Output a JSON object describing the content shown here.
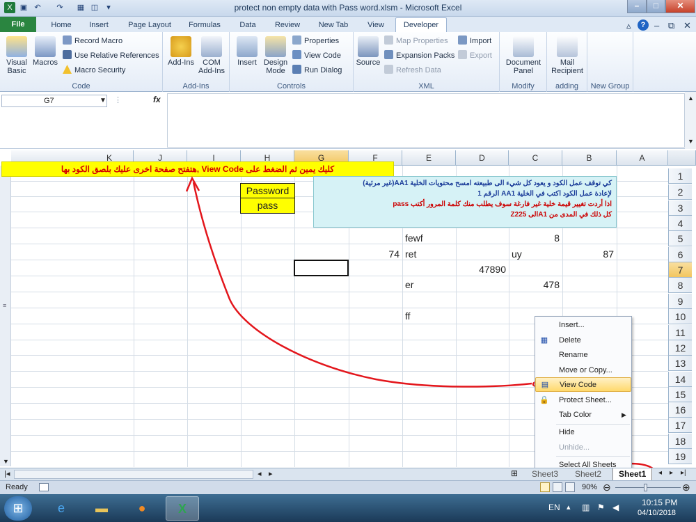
{
  "window": {
    "title": "protect non empty data with Pass word.xlsm  -  Microsoft Excel",
    "minimize": "–",
    "maximize": "□",
    "close": "✕"
  },
  "ribbon_tabs": [
    "File",
    "Home",
    "Insert",
    "Page Layout",
    "Formulas",
    "Data",
    "Review",
    "New Tab",
    "View",
    "Developer"
  ],
  "active_tab": "Developer",
  "groups": {
    "code": {
      "label": "Code",
      "visual_basic": "Visual\nBasic",
      "macros": "Macros",
      "record_macro": "Record Macro",
      "relative_refs": "Use Relative References",
      "macro_security": "Macro Security"
    },
    "addins": {
      "label": "Add-Ins",
      "addins": "Add-Ins",
      "com_addins": "COM\nAdd-Ins"
    },
    "controls": {
      "label": "Controls",
      "insert": "Insert",
      "design_mode": "Design\nMode",
      "properties": "Properties",
      "view_code": "View Code",
      "run_dialog": "Run Dialog"
    },
    "xml": {
      "label": "XML",
      "source": "Source",
      "map_properties": "Map Properties",
      "expansion_packs": "Expansion Packs",
      "refresh_data": "Refresh Data",
      "import": "Import",
      "export": "Export"
    },
    "modify": {
      "label": "Modify",
      "document_panel": "Document\nPanel"
    },
    "adding": {
      "label": "adding",
      "mail_recipient": "Mail\nRecipient"
    },
    "new_group": {
      "label": "New Group"
    }
  },
  "formula_bar": {
    "name_box": "G7",
    "fx": "fx",
    "value": ""
  },
  "columns": [
    "A",
    "B",
    "C",
    "D",
    "E",
    "F",
    "G",
    "H",
    "I",
    "J",
    "K"
  ],
  "rows": [
    "1",
    "2",
    "3",
    "4",
    "5",
    "6",
    "7",
    "8",
    "9",
    "10",
    "11",
    "12",
    "13",
    "14",
    "15",
    "16",
    "17",
    "18",
    "19"
  ],
  "selected_cell": {
    "col": "G",
    "row": "7"
  },
  "cells": {
    "e5": "fewf",
    "c5": "8",
    "f6": "74",
    "e6": "ret",
    "c6": "uy",
    "b6": "87",
    "d7": "47890",
    "e8": "er",
    "c8": "478",
    "e10": "ff"
  },
  "banner": "كليك يمين ثم الضغط على View Code ,هتفتح صفحة اخرى عليك بلصق الكود بها",
  "password_box": {
    "label": "Password",
    "value": "pass"
  },
  "note": {
    "line1": "كي توقف عمل الكود و يعود كل شيء الى طبيعته امسح محتويات الخلية AA1(غير مرئية)",
    "line2": "لإعادة عمل الكود اكتب في الخلية AA1 الرقم 1",
    "line3": "اذا أردت تغيير قيمة خلية غير فارغة سوف يطلب منك كلمة المرور  أكتب  pass",
    "line4": "كل ذلك في المدى من A1الى Z225"
  },
  "context_menu": {
    "insert": "Insert...",
    "delete": "Delete",
    "rename": "Rename",
    "move_copy": "Move or Copy...",
    "view_code": "View Code",
    "protect_sheet": "Protect Sheet...",
    "tab_color": "Tab Color",
    "hide": "Hide",
    "unhide": "Unhide...",
    "select_all": "Select All Sheets"
  },
  "sheets": [
    "Sheet3",
    "Sheet2",
    "Sheet1"
  ],
  "active_sheet": "Sheet1",
  "status": {
    "ready": "Ready",
    "zoom": "90%"
  },
  "taskbar": {
    "lang": "EN",
    "time": "10:15 PM",
    "date": "04/10/2018"
  },
  "colors": {
    "banner": "#ffff00",
    "banner_text": "#d40000",
    "annotation": "#e3161c",
    "file_tab": "#2a8540"
  }
}
